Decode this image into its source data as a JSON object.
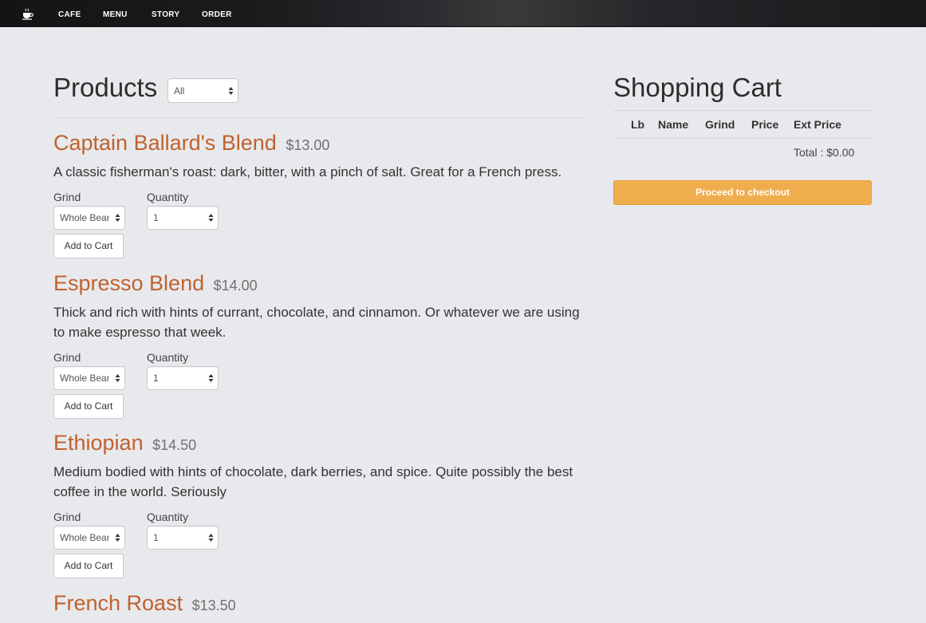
{
  "nav": {
    "items": [
      {
        "label": "CAFE"
      },
      {
        "label": "MENU"
      },
      {
        "label": "STORY"
      },
      {
        "label": "ORDER"
      }
    ]
  },
  "products": {
    "heading": "Products",
    "filter_value": "All",
    "grind_label": "Grind",
    "quantity_label": "Quantity",
    "add_label": "Add to Cart",
    "items": [
      {
        "name": "Captain Ballard's Blend",
        "price": "$13.00",
        "description": "A classic fisherman's roast: dark, bitter, with a pinch of salt. Great for a French press.",
        "grind_value": "Whole Bean",
        "quantity_value": "1"
      },
      {
        "name": "Espresso Blend",
        "price": "$14.00",
        "description": "Thick and rich with hints of currant, chocolate, and cinnamon. Or whatever we are using to make espresso that week.",
        "grind_value": "Whole Bean",
        "quantity_value": "1"
      },
      {
        "name": "Ethiopian",
        "price": "$14.50",
        "description": "Medium bodied with hints of chocolate, dark berries, and spice. Quite possibly the best coffee in the world. Seriously",
        "grind_value": "Whole Bean",
        "quantity_value": "1"
      },
      {
        "name": "French Roast",
        "price": "$13.50"
      }
    ]
  },
  "cart": {
    "heading": "Shopping Cart",
    "columns": [
      "Lb",
      "Name",
      "Grind",
      "Price",
      "Ext Price"
    ],
    "total": "Total : $0.00",
    "checkout_label": "Proceed to checkout"
  },
  "colors": {
    "accent": "#c0622e",
    "checkout": "#f0ad4e",
    "background": "#e8e9ec"
  },
  "icons": {
    "logo": "coffee-cup-icon",
    "select_arrows": "select-arrows-icon"
  }
}
